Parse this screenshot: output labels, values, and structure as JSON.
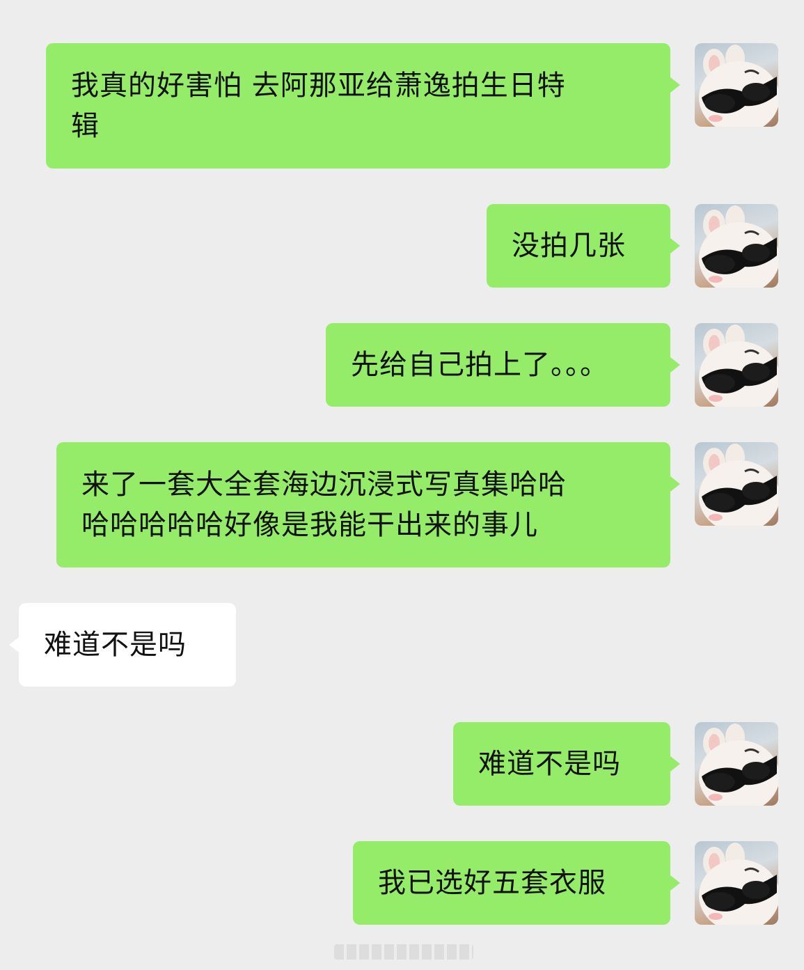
{
  "theme": {
    "background": "#ededed",
    "sent_bubble_color": "#95ec69",
    "received_bubble_color": "#ffffff",
    "text_color": "#111111"
  },
  "messages": [
    {
      "sender": "me",
      "text": "我真的好害怕 去阿那亚给萧逸拍生日特\n辑",
      "avatar_icon": "bunny-sunglasses-avatar-icon"
    },
    {
      "sender": "me",
      "text": "没拍几张",
      "avatar_icon": "bunny-sunglasses-avatar-icon"
    },
    {
      "sender": "me",
      "text": "先给自己拍上了。。。",
      "avatar_icon": "bunny-sunglasses-avatar-icon"
    },
    {
      "sender": "me",
      "text": "来了一套大全套海边沉浸式写真集哈哈\n哈哈哈哈哈好像是我能干出来的事儿",
      "avatar_icon": "bunny-sunglasses-avatar-icon"
    },
    {
      "sender": "other",
      "text": "难道不是吗"
    },
    {
      "sender": "me",
      "text": "难道不是吗",
      "avatar_icon": "bunny-sunglasses-avatar-icon"
    },
    {
      "sender": "me",
      "text": "我已选好五套衣服",
      "avatar_icon": "bunny-sunglasses-avatar-icon"
    }
  ]
}
